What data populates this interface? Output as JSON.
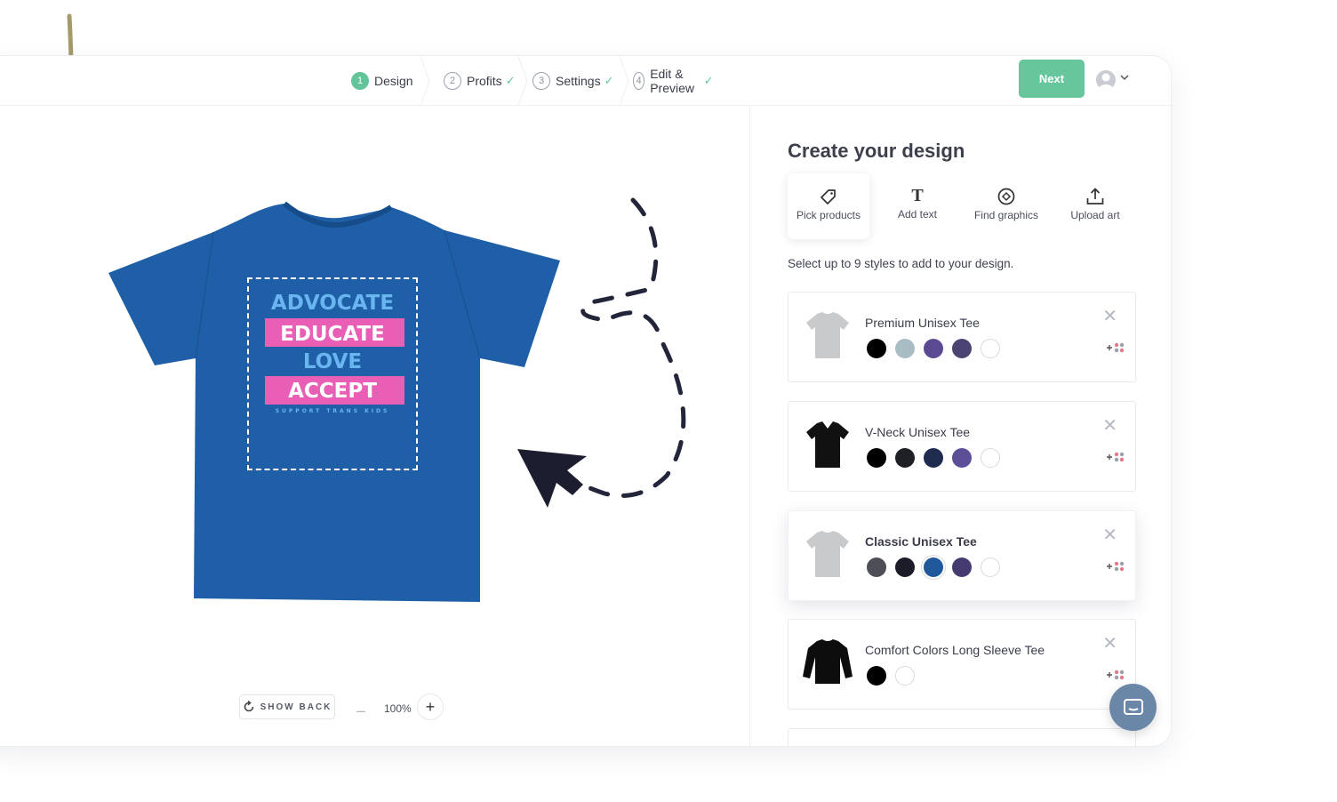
{
  "topbar": {
    "steps": [
      {
        "number": "1",
        "label": "Design",
        "state": "active"
      },
      {
        "number": "2",
        "label": "Profits",
        "state": "complete"
      },
      {
        "number": "3",
        "label": "Settings",
        "state": "complete"
      },
      {
        "number": "4",
        "label": "Edit & Preview",
        "state": "complete"
      }
    ],
    "next_label": "Next"
  },
  "design": {
    "shirt_color": "#1f5fa8",
    "lines": [
      "ADVOCATE",
      "EDUCATE",
      "LOVE",
      "ACCEPT"
    ],
    "tagline": "SUPPORT TRANS KIDS",
    "accent_pink": "#ea5fb6",
    "accent_blue": "#68b5f0"
  },
  "canvas": {
    "show_back_label": "SHOW BACK",
    "zoom_level": "100%"
  },
  "panel": {
    "title": "Create your design",
    "tools": [
      {
        "label": "Pick products",
        "icon": "tag-icon"
      },
      {
        "label": "Add text",
        "icon": "text-icon"
      },
      {
        "label": "Find graphics",
        "icon": "graphics-icon"
      },
      {
        "label": "Upload art",
        "icon": "upload-icon"
      }
    ],
    "hint": "Select up to 9 styles to add to your design.",
    "products": [
      {
        "name": "Premium Unisex Tee",
        "thumb_color": "#c9cacc",
        "colors": [
          "#000000",
          "#a9bcc4",
          "#5b4a92",
          "#4b4371",
          "#ffffff"
        ]
      },
      {
        "name": "V-Neck Unisex Tee",
        "thumb_color": "#111111",
        "colors": [
          "#000000",
          "#1f1f26",
          "#1f2c4f",
          "#5c4f97",
          "#ffffff"
        ]
      },
      {
        "name": "Classic Unisex Tee",
        "thumb_color": "#c9cacc",
        "colors": [
          "#4e4e56",
          "#1c1c28",
          "#20589c",
          "#463b70",
          "#ffffff"
        ]
      },
      {
        "name": "Comfort Colors Long Sleeve Tee",
        "thumb_color": "#0d0d0d",
        "colors": [
          "#000000",
          "#ffffff"
        ]
      }
    ]
  }
}
